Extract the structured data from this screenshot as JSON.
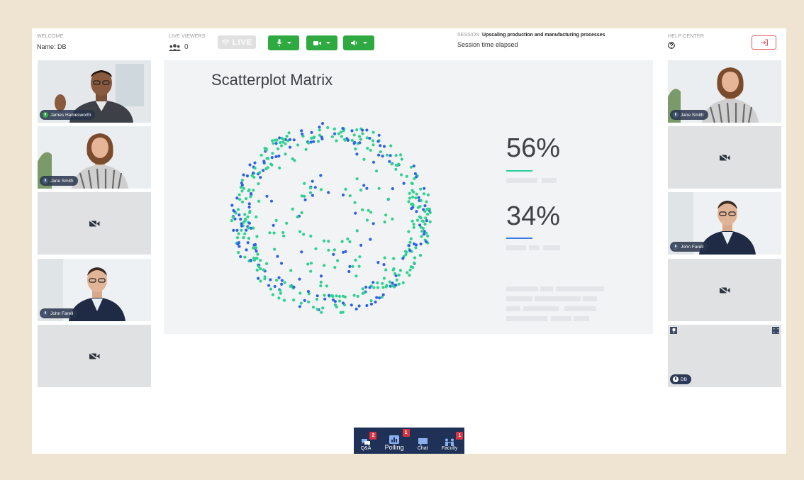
{
  "header": {
    "welcome_label": "WELCOME",
    "name_value": "Name: DB",
    "viewers_label": "LIVE VIEWERS",
    "viewers_count": "0",
    "live_label": "LIVE",
    "session_label": "SESSION :",
    "session_title": "Upscaling production and manufacturing processes",
    "session_time": "Session time elapsed",
    "help_label": "HELP CENTER"
  },
  "left_tiles": [
    {
      "name": "James Hamesworth",
      "video": true,
      "mic": "active"
    },
    {
      "name": "Jane Smith",
      "video": true,
      "mic": "muted"
    },
    {
      "name": "",
      "video": false
    },
    {
      "name": "John Farell",
      "video": true,
      "mic": "muted"
    },
    {
      "name": "",
      "video": false
    }
  ],
  "right_tiles": [
    {
      "name": "Jane Smith",
      "video": true,
      "mic": "muted"
    },
    {
      "name": "",
      "video": false
    },
    {
      "name": "John Farell",
      "video": true,
      "mic": "muted"
    },
    {
      "name": "",
      "video": false
    },
    {
      "name": "DB",
      "video": false,
      "self": true
    }
  ],
  "slide": {
    "title": "Scatterplot Matrix",
    "stat1": "56%",
    "stat2": "34%",
    "stat1_color": "#2ecc9a",
    "stat2_color": "#3d7be0"
  },
  "colors": {
    "accent_green": "#2eaa40",
    "navy": "#1f3157",
    "badge_red": "#d8333f",
    "dot_green": "#2fd18f",
    "dot_blue": "#2f63e6"
  },
  "bottom_bar": [
    {
      "label": "Q&A",
      "icon": "qa-icon",
      "badge": "2"
    },
    {
      "label": "Polling",
      "icon": "polling-icon",
      "badge": "1"
    },
    {
      "label": "Chat",
      "icon": "chat-icon",
      "badge": ""
    },
    {
      "label": "Faculty",
      "icon": "faculty-icon",
      "badge": "1"
    }
  ]
}
